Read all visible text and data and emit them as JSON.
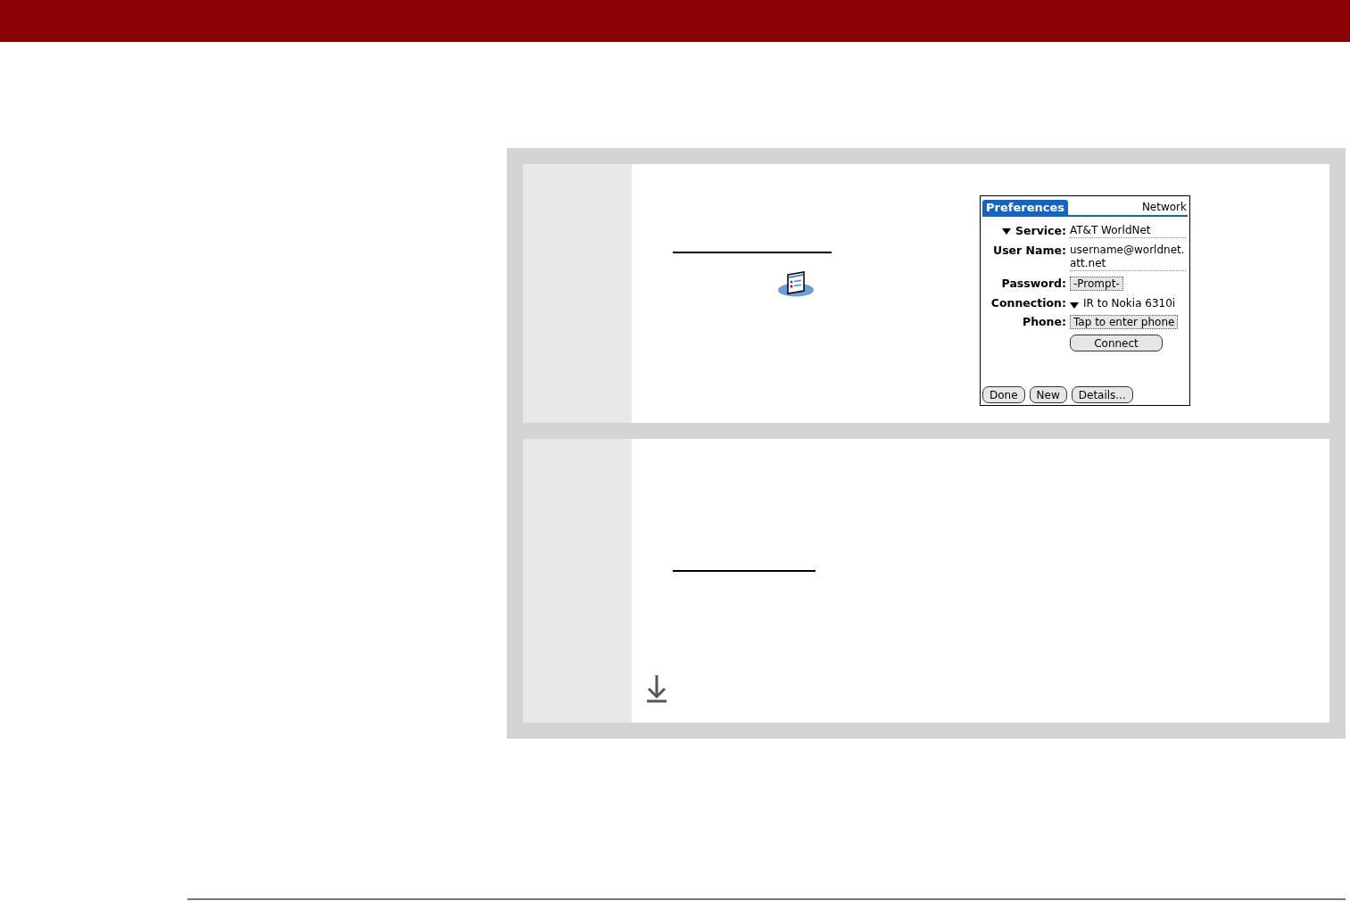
{
  "palm_screen": {
    "title": "Preferences",
    "category": "Network",
    "fields": [
      {
        "kind": "label_picker",
        "label": "Service:",
        "value": "AT&T WorldNet"
      },
      {
        "kind": "text",
        "label": "User Name:",
        "value": "username@worldnet.",
        "value_2": "att.net"
      },
      {
        "kind": "selector",
        "label": "Password:",
        "value": "-Prompt-"
      },
      {
        "kind": "value_picker",
        "label": "Connection:",
        "value": "IR to Nokia 6310i"
      },
      {
        "kind": "selector",
        "label": "Phone:",
        "value": "Tap to enter phone"
      }
    ],
    "connect_button": "Connect",
    "buttons": [
      "Done",
      "New",
      "Details..."
    ]
  }
}
